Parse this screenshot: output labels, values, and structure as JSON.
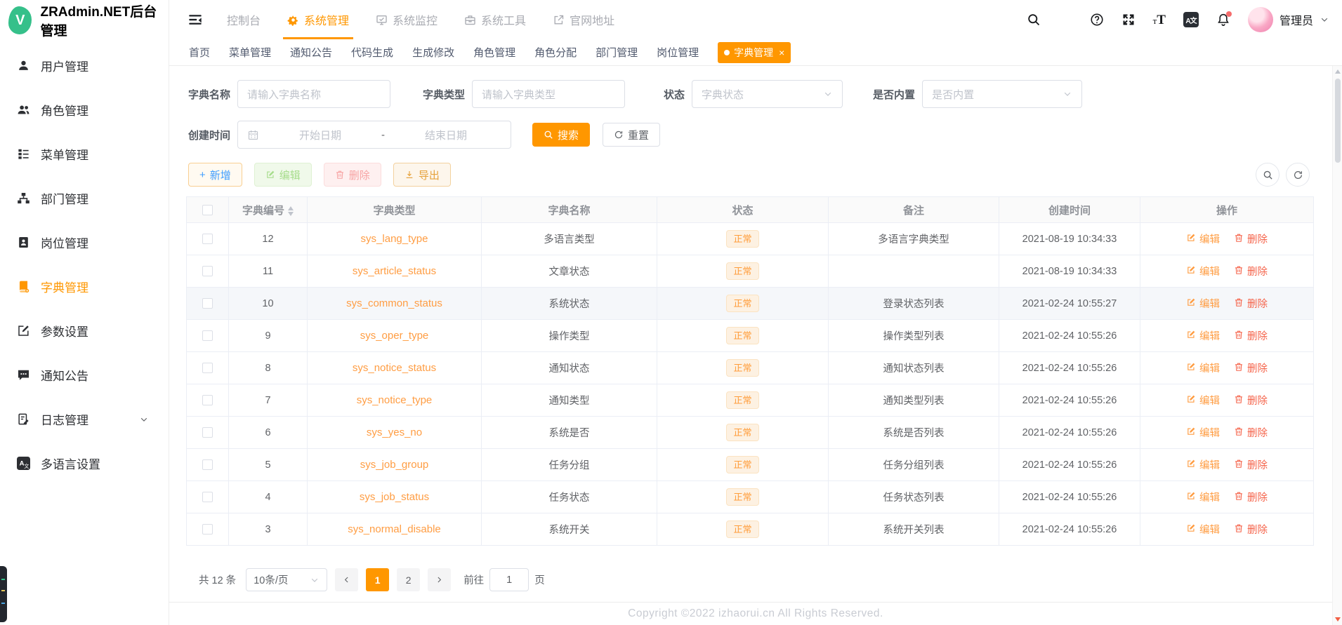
{
  "app": {
    "title": "ZRAdmin.NET后台管理",
    "logo_letter": "V"
  },
  "colors": {
    "primary": "#ff9700",
    "link": "#ff9d43",
    "danger": "#f5654c",
    "logo_green": "#35c08a"
  },
  "sidebar": {
    "items": [
      {
        "label": "用户管理",
        "icon": "user",
        "active": false
      },
      {
        "label": "角色管理",
        "icon": "users",
        "active": false
      },
      {
        "label": "菜单管理",
        "icon": "menu",
        "active": false
      },
      {
        "label": "部门管理",
        "icon": "dept",
        "active": false
      },
      {
        "label": "岗位管理",
        "icon": "post",
        "active": false
      },
      {
        "label": "字典管理",
        "icon": "dict",
        "active": true
      },
      {
        "label": "参数设置",
        "icon": "param",
        "active": false
      },
      {
        "label": "通知公告",
        "icon": "notice",
        "active": false
      },
      {
        "label": "日志管理",
        "icon": "log",
        "active": false,
        "expandable": true
      },
      {
        "label": "多语言设置",
        "icon": "lang",
        "active": false
      }
    ]
  },
  "topnav": {
    "items": [
      {
        "label": "控制台",
        "icon": "",
        "active": false
      },
      {
        "label": "系统管理",
        "icon": "gear",
        "active": true
      },
      {
        "label": "系统监控",
        "icon": "monitor",
        "active": false
      },
      {
        "label": "系统工具",
        "icon": "toolbox",
        "active": false
      },
      {
        "label": "官网地址",
        "icon": "extlink",
        "active": false
      }
    ]
  },
  "header_right": {
    "username": "管理员"
  },
  "tabs": [
    {
      "label": "首页",
      "active": false
    },
    {
      "label": "菜单管理",
      "active": false
    },
    {
      "label": "通知公告",
      "active": false
    },
    {
      "label": "代码生成",
      "active": false
    },
    {
      "label": "生成修改",
      "active": false
    },
    {
      "label": "角色管理",
      "active": false
    },
    {
      "label": "角色分配",
      "active": false
    },
    {
      "label": "部门管理",
      "active": false
    },
    {
      "label": "岗位管理",
      "active": false
    },
    {
      "label": "字典管理",
      "active": true
    }
  ],
  "filters": {
    "name_label": "字典名称",
    "name_placeholder": "请输入字典名称",
    "type_label": "字典类型",
    "type_placeholder": "请输入字典类型",
    "status_label": "状态",
    "status_placeholder": "字典状态",
    "builtin_label": "是否内置",
    "builtin_placeholder": "是否内置",
    "time_label": "创建时间",
    "start_placeholder": "开始日期",
    "separator": "-",
    "end_placeholder": "结束日期",
    "search_label": "搜索",
    "reset_label": "重置"
  },
  "toolbar": {
    "add": "新增",
    "edit": "编辑",
    "delete": "删除",
    "export": "导出"
  },
  "table": {
    "columns": [
      "",
      "字典编号",
      "字典类型",
      "字典名称",
      "状态",
      "备注",
      "创建时间",
      "操作"
    ],
    "rows": [
      {
        "id": "12",
        "type": "sys_lang_type",
        "name": "多语言类型",
        "status": "正常",
        "remark": "多语言字典类型",
        "created": "2021-08-19 10:34:33",
        "highlight": false
      },
      {
        "id": "11",
        "type": "sys_article_status",
        "name": "文章状态",
        "status": "正常",
        "remark": "",
        "created": "2021-08-19 10:34:33",
        "highlight": false
      },
      {
        "id": "10",
        "type": "sys_common_status",
        "name": "系统状态",
        "status": "正常",
        "remark": "登录状态列表",
        "created": "2021-02-24 10:55:27",
        "highlight": true
      },
      {
        "id": "9",
        "type": "sys_oper_type",
        "name": "操作类型",
        "status": "正常",
        "remark": "操作类型列表",
        "created": "2021-02-24 10:55:26",
        "highlight": false
      },
      {
        "id": "8",
        "type": "sys_notice_status",
        "name": "通知状态",
        "status": "正常",
        "remark": "通知状态列表",
        "created": "2021-02-24 10:55:26",
        "highlight": false
      },
      {
        "id": "7",
        "type": "sys_notice_type",
        "name": "通知类型",
        "status": "正常",
        "remark": "通知类型列表",
        "created": "2021-02-24 10:55:26",
        "highlight": false
      },
      {
        "id": "6",
        "type": "sys_yes_no",
        "name": "系统是否",
        "status": "正常",
        "remark": "系统是否列表",
        "created": "2021-02-24 10:55:26",
        "highlight": false
      },
      {
        "id": "5",
        "type": "sys_job_group",
        "name": "任务分组",
        "status": "正常",
        "remark": "任务分组列表",
        "created": "2021-02-24 10:55:26",
        "highlight": false
      },
      {
        "id": "4",
        "type": "sys_job_status",
        "name": "任务状态",
        "status": "正常",
        "remark": "任务状态列表",
        "created": "2021-02-24 10:55:26",
        "highlight": false
      },
      {
        "id": "3",
        "type": "sys_normal_disable",
        "name": "系统开关",
        "status": "正常",
        "remark": "系统开关列表",
        "created": "2021-02-24 10:55:26",
        "highlight": false
      }
    ]
  },
  "row_actions": {
    "edit": "编辑",
    "delete": "删除"
  },
  "pagination": {
    "total": "共 12 条",
    "size": "10条/页",
    "pages": [
      "1",
      "2"
    ],
    "active_page": "1",
    "goto": "前往",
    "goto_value": "1",
    "unit": "页"
  },
  "footer": {
    "copyright": "Copyright ©2022 izhaorui.cn All Rights Reserved."
  }
}
